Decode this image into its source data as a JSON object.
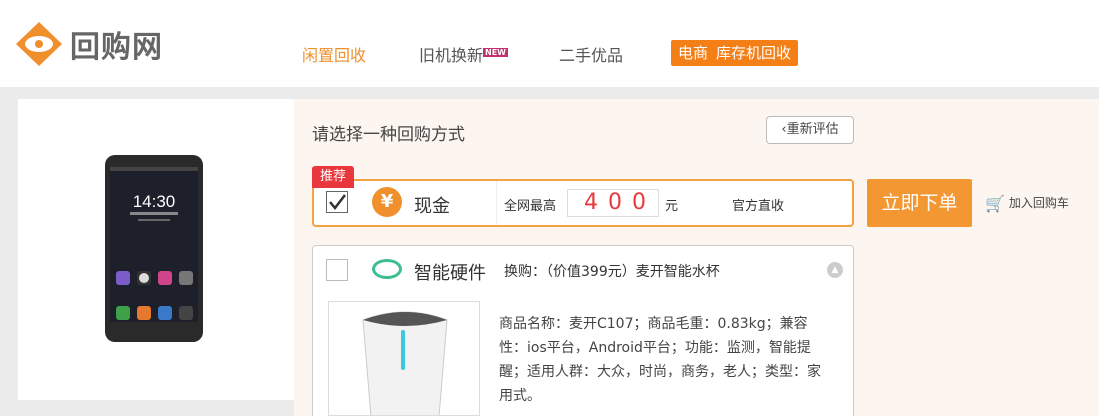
{
  "header": {
    "logo_text": "回购网",
    "nav": [
      {
        "label": "闲置回收"
      },
      {
        "label": "旧机换新",
        "badge": "NEW"
      },
      {
        "label": "二手优品"
      }
    ],
    "promo": {
      "part1": "电商",
      "part2": "库存机回收"
    }
  },
  "main": {
    "title": "请选择一种回购方式",
    "reevaluate_label": "重新评估",
    "recommend_tag": "推荐",
    "cash_option": {
      "label": "现金",
      "price_prefix": "全网最高",
      "price": "400",
      "unit": "元",
      "official": "官方直收"
    },
    "order_button": "立即下单",
    "cart_label": "加入回购车",
    "hardware_option": {
      "label": "智能硬件",
      "swap_text": "换购：（价值399元）麦开智能水杯",
      "description": "商品名称：麦开C107；商品毛重：0.83kg；兼容性：ios平台，Android平台；功能：监测，智能提醒；适用人群：大众，时尚，商务，老人；类型：家用式。"
    },
    "phone_screen_time": "14:30"
  },
  "colors": {
    "accent": "#f0902c",
    "promo": "#f57f17",
    "red": "#e8383d",
    "green": "#3bbf8f"
  }
}
